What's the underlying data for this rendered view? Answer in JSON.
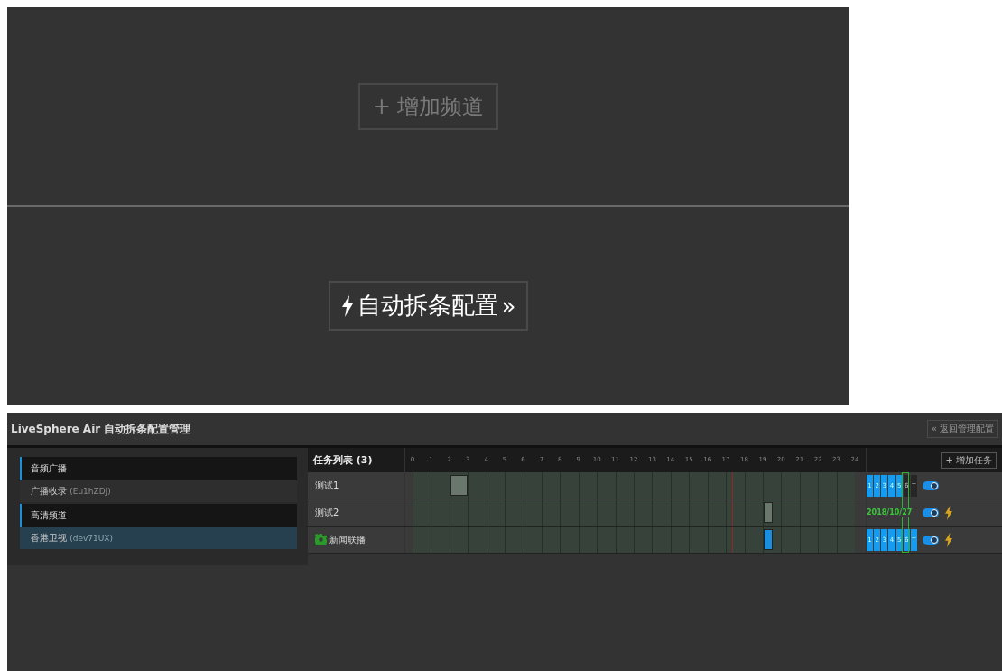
{
  "top": {
    "add_channel": "+ 增加频道",
    "auto_config": "自动拆条配置",
    "auto_config_arrow": "»"
  },
  "header": {
    "title": "LiveSphere Air 自动拆条配置管理",
    "back": "« 返回管理配置"
  },
  "channels": [
    {
      "title": "音频广播",
      "items": [
        {
          "name": "广播收录",
          "code": "(Eu1hZDJ)",
          "selected": false
        }
      ]
    },
    {
      "title": "高清频道",
      "items": [
        {
          "name": "香港卫视",
          "code": "(dev71UX)",
          "selected": true
        }
      ]
    }
  ],
  "tasks": {
    "title": "任务列表 (3)",
    "add": "+ 增加任务",
    "hours": [
      "0",
      "1",
      "2",
      "3",
      "4",
      "5",
      "6",
      "7",
      "8",
      "9",
      "10",
      "11",
      "12",
      "13",
      "14",
      "15",
      "16",
      "17",
      "18",
      "19",
      "20",
      "21",
      "22",
      "23",
      "24"
    ],
    "day_elapsed": {
      "level": 0.722
    },
    "rows": [
      {
        "name": "测试1",
        "running": false,
        "active": false,
        "schedule": [
          {
            "kind": "empty"
          },
          {
            "kind": "empty"
          },
          {
            "kind": "full"
          },
          {
            "kind": "empty"
          },
          {
            "kind": "empty"
          },
          {
            "kind": "empty"
          },
          {
            "kind": "empty"
          },
          {
            "kind": "empty"
          },
          {
            "kind": "empty"
          },
          {
            "kind": "empty"
          },
          {
            "kind": "empty"
          },
          {
            "kind": "empty"
          },
          {
            "kind": "empty"
          },
          {
            "kind": "empty"
          },
          {
            "kind": "empty"
          },
          {
            "kind": "empty"
          },
          {
            "kind": "empty"
          },
          {
            "kind": "empty"
          },
          {
            "kind": "empty"
          },
          {
            "kind": "empty"
          },
          {
            "kind": "empty"
          },
          {
            "kind": "empty"
          },
          {
            "kind": "empty"
          },
          {
            "kind": "empty"
          }
        ],
        "days": [
          {
            "label": "1",
            "selected": true
          },
          {
            "label": "2",
            "selected": true
          },
          {
            "label": "3",
            "selected": true
          },
          {
            "label": "4",
            "selected": true
          },
          {
            "label": "5",
            "selected": true
          },
          {
            "label": "6",
            "selected": false
          },
          {
            "label": "T",
            "selected": false
          }
        ],
        "on": true,
        "bolt": false
      },
      {
        "name": "测试2",
        "running": false,
        "active": false,
        "schedule": [
          {
            "kind": "empty"
          },
          {
            "kind": "empty"
          },
          {
            "kind": "empty"
          },
          {
            "kind": "empty"
          },
          {
            "kind": "empty"
          },
          {
            "kind": "empty"
          },
          {
            "kind": "empty"
          },
          {
            "kind": "empty"
          },
          {
            "kind": "empty"
          },
          {
            "kind": "empty"
          },
          {
            "kind": "empty"
          },
          {
            "kind": "empty"
          },
          {
            "kind": "empty"
          },
          {
            "kind": "empty"
          },
          {
            "kind": "empty"
          },
          {
            "kind": "empty"
          },
          {
            "kind": "empty"
          },
          {
            "kind": "empty"
          },
          {
            "kind": "empty"
          },
          {
            "kind": "half"
          },
          {
            "kind": "empty"
          },
          {
            "kind": "empty"
          },
          {
            "kind": "empty"
          },
          {
            "kind": "empty"
          }
        ],
        "date": "2018/10/27",
        "on": true,
        "bolt": true
      },
      {
        "name": "新闻联播",
        "running": true,
        "active": true,
        "schedule": [
          {
            "kind": "empty"
          },
          {
            "kind": "empty"
          },
          {
            "kind": "empty"
          },
          {
            "kind": "empty"
          },
          {
            "kind": "empty"
          },
          {
            "kind": "empty"
          },
          {
            "kind": "empty"
          },
          {
            "kind": "empty"
          },
          {
            "kind": "empty"
          },
          {
            "kind": "empty"
          },
          {
            "kind": "empty"
          },
          {
            "kind": "empty"
          },
          {
            "kind": "empty"
          },
          {
            "kind": "empty"
          },
          {
            "kind": "empty"
          },
          {
            "kind": "empty"
          },
          {
            "kind": "empty"
          },
          {
            "kind": "empty"
          },
          {
            "kind": "empty"
          },
          {
            "kind": "half"
          },
          {
            "kind": "empty"
          },
          {
            "kind": "empty"
          },
          {
            "kind": "empty"
          },
          {
            "kind": "empty"
          }
        ],
        "days": [
          {
            "label": "1",
            "selected": true
          },
          {
            "label": "2",
            "selected": true
          },
          {
            "label": "3",
            "selected": true
          },
          {
            "label": "4",
            "selected": true
          },
          {
            "label": "5",
            "selected": true
          },
          {
            "label": "6",
            "selected": true
          },
          {
            "label": "T",
            "selected": true
          }
        ],
        "on": true,
        "bolt": true
      }
    ]
  }
}
